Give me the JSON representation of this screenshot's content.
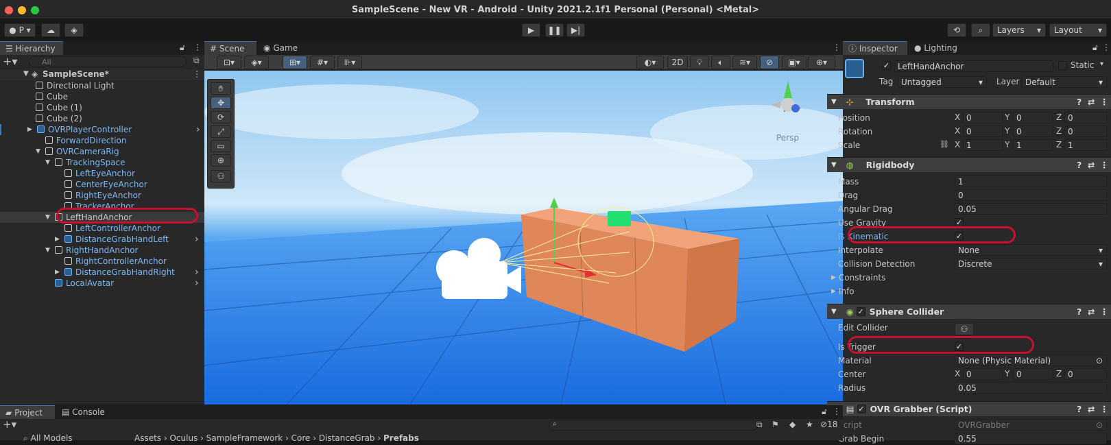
{
  "window": {
    "title": "SampleScene - New VR - Android - Unity 2021.2.1f1 Personal (Personal) <Metal>"
  },
  "toolbar": {
    "account": "P",
    "layers": "Layers",
    "layout": "Layout"
  },
  "hierarchy": {
    "tab": "Hierarchy",
    "search_placeholder": "All",
    "scene": "SampleScene*",
    "items": [
      {
        "label": "Directional Light"
      },
      {
        "label": "Cube"
      },
      {
        "label": "Cube (1)"
      },
      {
        "label": "Cube (2)"
      },
      {
        "label": "OVRPlayerController"
      },
      {
        "label": "ForwardDirection"
      },
      {
        "label": "OVRCameraRig"
      },
      {
        "label": "TrackingSpace"
      },
      {
        "label": "LeftEyeAnchor"
      },
      {
        "label": "CenterEyeAnchor"
      },
      {
        "label": "RightEyeAnchor"
      },
      {
        "label": "TrackerAnchor"
      },
      {
        "label": "LeftHandAnchor"
      },
      {
        "label": "LeftControllerAnchor"
      },
      {
        "label": "DistanceGrabHandLeft"
      },
      {
        "label": "RightHandAnchor"
      },
      {
        "label": "RightControllerAnchor"
      },
      {
        "label": "DistanceGrabHandRight"
      },
      {
        "label": "LocalAvatar"
      }
    ]
  },
  "scene_view": {
    "tabs": [
      "Scene",
      "Game"
    ],
    "mode_2d": "2D",
    "persp": "Persp"
  },
  "inspector": {
    "tabs": [
      "Inspector",
      "Lighting"
    ],
    "object_name": "LeftHandAnchor",
    "static": "Static",
    "tag_label": "Tag",
    "tag_value": "Untagged",
    "layer_label": "Layer",
    "layer_value": "Default",
    "transform": {
      "title": "Transform",
      "position": "Position",
      "rotation": "Rotation",
      "scale": "Scale",
      "pos": [
        "0",
        "0",
        "0"
      ],
      "rot": [
        "0",
        "0",
        "0"
      ],
      "scl": [
        "1",
        "1",
        "1"
      ]
    },
    "rigidbody": {
      "title": "Rigidbody",
      "mass_label": "Mass",
      "mass": "1",
      "drag_label": "Drag",
      "drag": "0",
      "angular_label": "Angular Drag",
      "angular": "0.05",
      "gravity_label": "Use Gravity",
      "kinematic_label": "Is Kinematic",
      "interp_label": "Interpolate",
      "interp": "None",
      "collision_label": "Collision Detection",
      "collision": "Discrete",
      "constraints": "Constraints",
      "info": "Info"
    },
    "sphere": {
      "title": "Sphere Collider",
      "edit_label": "Edit Collider",
      "trigger_label": "Is Trigger",
      "material_label": "Material",
      "material": "None (Physic Material)",
      "center_label": "Center",
      "center": [
        "0",
        "0",
        "0"
      ],
      "radius_label": "Radius",
      "radius": "0.05"
    },
    "grabber": {
      "title": "OVR Grabber (Script)",
      "script_label": "Script",
      "script": "OVRGrabber",
      "grab_label": "Grab Begin",
      "grab": "0.55"
    }
  },
  "bottom": {
    "tabs": [
      "Project",
      "Console"
    ],
    "count": "18",
    "favorites": "All Models",
    "breadcrumb": [
      "Assets",
      "Oculus",
      "SampleFramework",
      "Core",
      "DistanceGrab",
      "Prefabs"
    ]
  },
  "colors": {
    "accent": "#3a79bb",
    "highlight": "#c8102e",
    "cube": "#e08a56"
  }
}
